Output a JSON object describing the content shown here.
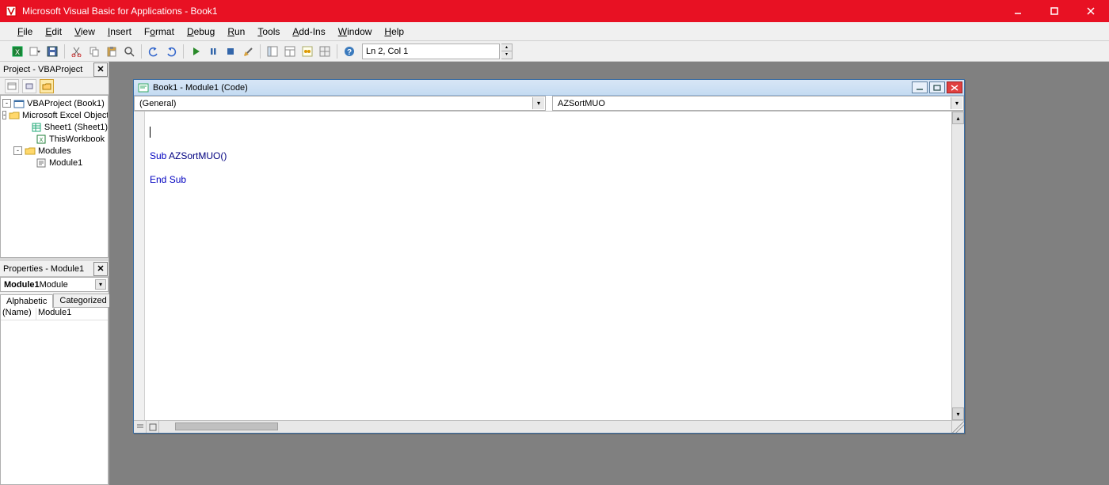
{
  "titlebar": {
    "title": "Microsoft Visual Basic for Applications - Book1"
  },
  "menus": [
    {
      "label": "File",
      "accel_index": 0
    },
    {
      "label": "Edit",
      "accel_index": 0
    },
    {
      "label": "View",
      "accel_index": 0
    },
    {
      "label": "Insert",
      "accel_index": 0
    },
    {
      "label": "Format",
      "accel_index": 1
    },
    {
      "label": "Debug",
      "accel_index": 0
    },
    {
      "label": "Run",
      "accel_index": 0
    },
    {
      "label": "Tools",
      "accel_index": 0
    },
    {
      "label": "Add-Ins",
      "accel_index": 0
    },
    {
      "label": "Window",
      "accel_index": 0
    },
    {
      "label": "Help",
      "accel_index": 0
    }
  ],
  "toolbar": {
    "buttons": [
      "view-excel-icon",
      "insert-dropdown-icon",
      "save-icon",
      "sep",
      "cut-icon",
      "copy-icon",
      "paste-icon",
      "find-icon",
      "sep",
      "undo-icon",
      "redo-icon",
      "sep",
      "run-icon",
      "break-icon",
      "reset-icon",
      "design-mode-icon",
      "sep",
      "project-explorer-icon",
      "properties-window-icon",
      "object-browser-icon",
      "toolbox-icon",
      "sep",
      "help-icon"
    ],
    "status": "Ln 2, Col 1"
  },
  "project_pane": {
    "title": "Project - VBAProject",
    "tree": [
      {
        "depth": 0,
        "toggle": "-",
        "icon": "project-icon",
        "label": "VBAProject (Book1)"
      },
      {
        "depth": 1,
        "toggle": "-",
        "icon": "folder-icon",
        "label": "Microsoft Excel Objects"
      },
      {
        "depth": 2,
        "toggle": "",
        "icon": "sheet-icon",
        "label": "Sheet1 (Sheet1)"
      },
      {
        "depth": 2,
        "toggle": "",
        "icon": "workbook-icon",
        "label": "ThisWorkbook"
      },
      {
        "depth": 1,
        "toggle": "-",
        "icon": "folder-icon",
        "label": "Modules"
      },
      {
        "depth": 2,
        "toggle": "",
        "icon": "module-icon",
        "label": "Module1"
      }
    ]
  },
  "properties_pane": {
    "title": "Properties - Module1",
    "object_selector_bold": "Module1",
    "object_selector_rest": " Module",
    "tabs": {
      "alphabetic": "Alphabetic",
      "categorized": "Categorized"
    },
    "rows": [
      {
        "name": "(Name)",
        "value": "Module1"
      }
    ]
  },
  "code_window": {
    "title": "Book1 - Module1 (Code)",
    "left_dropdown": "(General)",
    "right_dropdown": "AZSortMUO",
    "lines": [
      "Sub AZSortMUO()",
      "",
      "End Sub"
    ]
  }
}
